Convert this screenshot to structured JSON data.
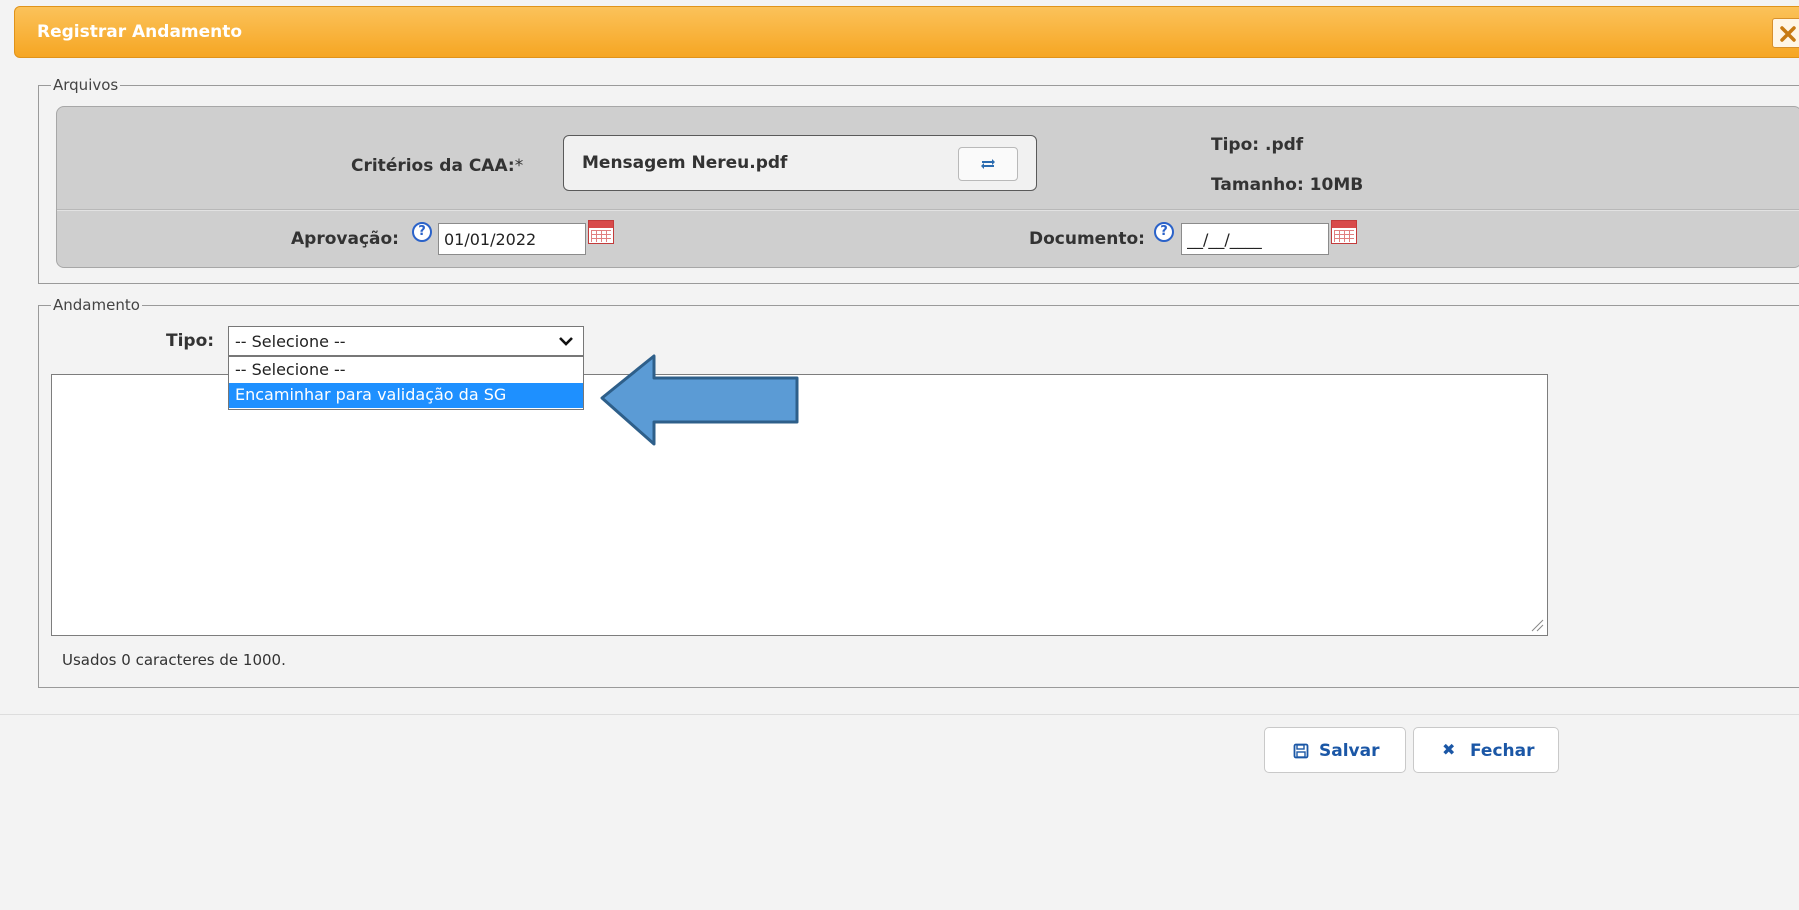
{
  "dialog": {
    "title": "Registrar Andamento"
  },
  "arquivos": {
    "legend": "Arquivos",
    "criterios_label": "Critérios da CAA:",
    "criterios_required": "*",
    "file_name": "Mensagem Nereu.pdf",
    "tipo_text": "Tipo: .pdf",
    "tamanho_text": "Tamanho: 10MB",
    "aprovacao_label": "Aprovação:",
    "aprovacao_value": "01/01/2022",
    "documento_label": "Documento:",
    "documento_value": "__/__/____",
    "help_glyph": "?"
  },
  "andamento": {
    "legend": "Andamento",
    "tipo_label": "Tipo:",
    "tipo_selected": "-- Selecione --",
    "options": [
      "-- Selecione --",
      "Encaminhar para validação da SG"
    ],
    "highlighted_option": 1,
    "text_value": "",
    "counter_text": "Usados 0 caracteres de 1000."
  },
  "footer": {
    "save_label": "Salvar",
    "close_label": "Fechar",
    "close_glyph": "✖"
  },
  "colors": {
    "titlebar": "#f6a623",
    "option_highlight": "#1e90ff",
    "arrow_fill": "#5b9bd5",
    "arrow_stroke": "#2e5f8a",
    "button_text": "#1b57a6"
  }
}
